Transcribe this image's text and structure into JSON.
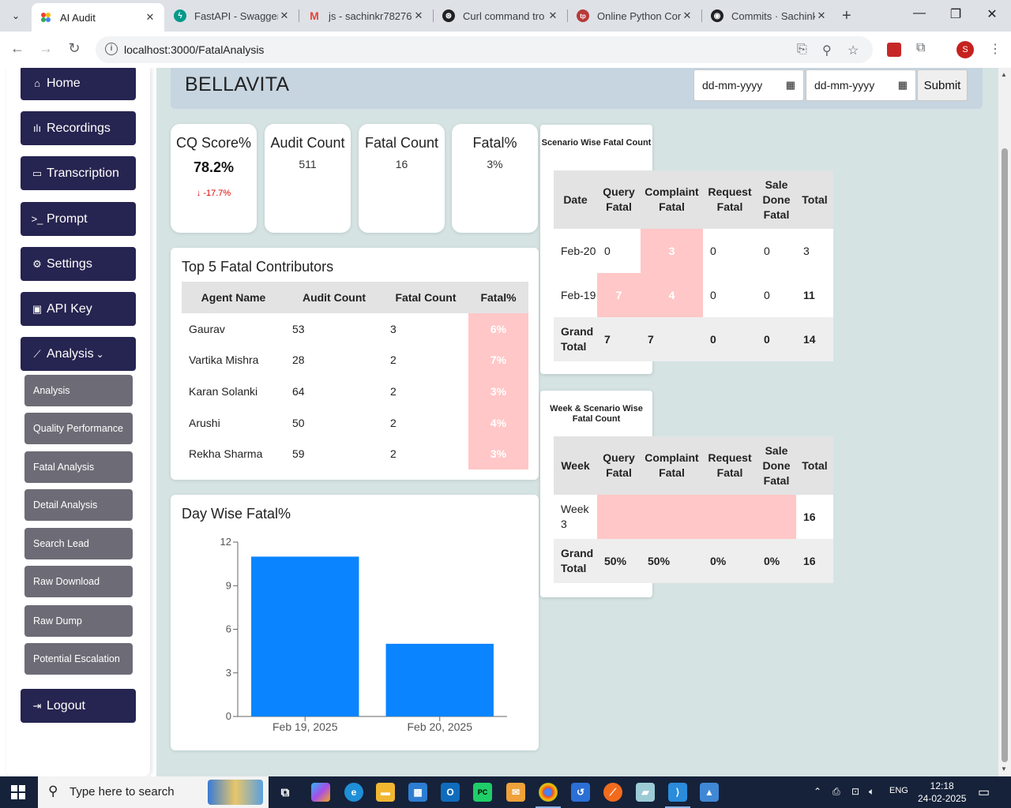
{
  "browser": {
    "tabs": [
      {
        "title": "AI Audit",
        "active": true,
        "favicon": "ai-audit-favicon",
        "color": "#e8453c"
      },
      {
        "title": "FastAPI - Swagger",
        "active": false,
        "favicon": "fastapi-favicon",
        "color": "#05998b"
      },
      {
        "title": "js - sachinkr78276",
        "active": false,
        "favicon": "gmail-favicon",
        "color": "#ea4335"
      },
      {
        "title": "Curl command tro",
        "active": false,
        "favicon": "openai-favicon",
        "color": "#202124"
      },
      {
        "title": "Online Python Cor",
        "active": false,
        "favicon": "tutorialspoint-favicon",
        "color": "#b73a3a"
      },
      {
        "title": "Commits · Sachink",
        "active": false,
        "favicon": "github-favicon",
        "color": "#202124"
      }
    ],
    "url": "localhost:3000/FatalAnalysis",
    "profile_initial": "S"
  },
  "sidebar": {
    "primary": [
      {
        "label": "Home",
        "icon": "home-icon"
      },
      {
        "label": "Recordings",
        "icon": "waveform-icon"
      },
      {
        "label": "Transcription",
        "icon": "caption-icon"
      },
      {
        "label": "Prompt",
        "icon": "terminal-icon"
      },
      {
        "label": "Settings",
        "icon": "gear-icon"
      },
      {
        "label": "API Key",
        "icon": "key-file-icon"
      },
      {
        "label": "Analysis",
        "icon": "chart-line-icon"
      }
    ],
    "analysis_sub": [
      {
        "label": "Analysis"
      },
      {
        "label": "Quality Performance"
      },
      {
        "label": "Fatal Analysis"
      },
      {
        "label": "Detail Analysis"
      },
      {
        "label": "Search Lead"
      },
      {
        "label": "Raw Download"
      },
      {
        "label": "Raw Dump"
      },
      {
        "label": "Potential Escalation"
      }
    ],
    "logout": {
      "label": "Logout",
      "icon": "logout-icon"
    }
  },
  "header": {
    "brand": "BELLAVITA",
    "from_placeholder": "dd-mm-yyyy",
    "to_placeholder": "dd-mm-yyyy",
    "submit_label": "Submit"
  },
  "stats": [
    {
      "label": "CQ Score%",
      "value": "78.2%",
      "delta": "↓ -17.7%"
    },
    {
      "label": "Audit Count",
      "value": "511"
    },
    {
      "label": "Fatal Count",
      "value": "16"
    },
    {
      "label": "Fatal%",
      "value": "3%"
    }
  ],
  "top_contributors": {
    "title": "Top 5 Fatal Contributors",
    "columns": [
      "Agent Name",
      "Audit Count",
      "Fatal Count",
      "Fatal%"
    ],
    "rows": [
      [
        "Gaurav",
        "53",
        "3",
        "6%"
      ],
      [
        "Vartika Mishra",
        "28",
        "2",
        "7%"
      ],
      [
        "Karan Solanki",
        "64",
        "2",
        "3%"
      ],
      [
        "Arushi",
        "50",
        "2",
        "4%"
      ],
      [
        "Rekha Sharma",
        "59",
        "2",
        "3%"
      ]
    ]
  },
  "scenario_fatal": {
    "title": "Scenario Wise Fatal Count",
    "columns": [
      "Date",
      "Query Fatal",
      "Complaint Fatal",
      "Request Fatal",
      "Sale Done Fatal",
      "Total"
    ],
    "rows": [
      [
        "Feb-20",
        "0",
        "3",
        "0",
        "0",
        "3"
      ],
      [
        "Feb-19",
        "7",
        "4",
        "0",
        "0",
        "11"
      ]
    ],
    "grand": [
      "Grand Total",
      "7",
      "7",
      "0",
      "0",
      "14"
    ]
  },
  "week_fatal": {
    "title": "Week & Scenario Wise Fatal Count",
    "columns": [
      "Week",
      "Query Fatal",
      "Complaint Fatal",
      "Request Fatal",
      "Sale Done Fatal",
      "Total"
    ],
    "rows": [
      [
        "Week 3",
        "",
        "",
        "",
        "",
        "16"
      ]
    ],
    "grand": [
      "Grand Total",
      "50%",
      "50%",
      "0%",
      "0%",
      "16"
    ]
  },
  "chart_data": {
    "type": "bar",
    "title": "Day Wise Fatal%",
    "categories": [
      "Feb 19, 2025",
      "Feb 20, 2025"
    ],
    "values": [
      11,
      5
    ],
    "yticks": [
      0,
      3,
      6,
      9,
      12
    ],
    "ylim": [
      0,
      12
    ],
    "xlabel": "",
    "ylabel": "",
    "color": "#0a84ff",
    "grid": false
  },
  "taskbar": {
    "search_placeholder": "Type here to search",
    "language": "ENG",
    "time": "12:18",
    "date": "24-02-2025"
  }
}
